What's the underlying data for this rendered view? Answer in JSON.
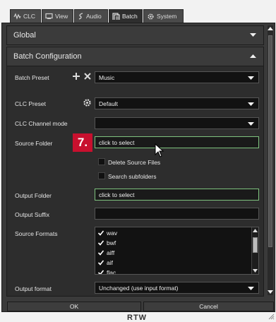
{
  "tabs": [
    {
      "label": "CLC",
      "icon": "waveform-icon"
    },
    {
      "label": "View",
      "icon": "monitor-icon"
    },
    {
      "label": "Audio",
      "icon": "audio-icon"
    },
    {
      "label": "Batch",
      "icon": "batch-icon"
    },
    {
      "label": "System",
      "icon": "gear-icon"
    }
  ],
  "global": {
    "title": "Global"
  },
  "batch": {
    "title": "Batch Configuration",
    "batch_preset_label": "Batch Preset",
    "batch_preset_value": "Music",
    "clc_preset_label": "CLC Preset",
    "clc_preset_value": "Default",
    "clc_channel_mode_label": "CLC Channel mode",
    "clc_channel_mode_value": "",
    "source_folder_label": "Source Folder",
    "source_folder_value": "click to select",
    "step_badge": "7.",
    "delete_source_label": "Delete Source Files",
    "search_subfolders_label": "Search subfolders",
    "output_folder_label": "Output Folder",
    "output_folder_value": "click to select",
    "output_suffix_label": "Output Suffix",
    "output_suffix_value": "",
    "source_formats_label": "Source Formats",
    "source_formats": [
      {
        "name": "wav",
        "checked": true
      },
      {
        "name": "bwf",
        "checked": true
      },
      {
        "name": "aiff",
        "checked": true
      },
      {
        "name": "aif",
        "checked": true
      },
      {
        "name": "flac",
        "checked": true
      }
    ],
    "output_format_label": "Output format",
    "output_format_value": "Unchanged (use input format)"
  },
  "footer": {
    "ok_label": "OK",
    "cancel_label": "Cancel"
  },
  "logo_text": "RTW",
  "colors": {
    "accent_green": "#7ec27e",
    "badge_red": "#c8102e",
    "panel_bg": "#2d2d2d"
  }
}
